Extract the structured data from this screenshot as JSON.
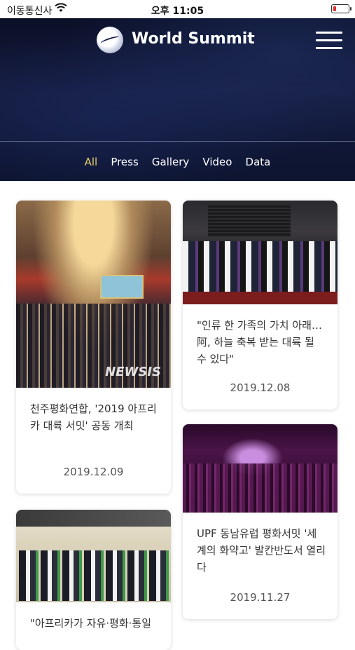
{
  "status": {
    "carrier": "이동통신사",
    "time": "오후 11:05"
  },
  "header": {
    "brand": "World Summit"
  },
  "tabs": [
    "All",
    "Press",
    "Gallery",
    "Video",
    "Data"
  ],
  "accent": "#e8cf6a",
  "cards": [
    {
      "title": "천주평화연합, '2019 아프리카 대륙 서밋' 공동 개최",
      "date": "2019.12.09",
      "watermark": "NEWSIS"
    },
    {
      "title": "\"인류 한 가족의 가치 아래… 阿, 하늘 축복 받는 대륙 될 수 있다\"",
      "date": "2019.12.08"
    },
    {
      "title": "UPF 동남유럽 평화서밋 '세계의 화약고' 발칸반도서 열리다",
      "date": "2019.11.27"
    },
    {
      "title": "\"아프리카가 자유·평화·통일",
      "date": ""
    }
  ]
}
